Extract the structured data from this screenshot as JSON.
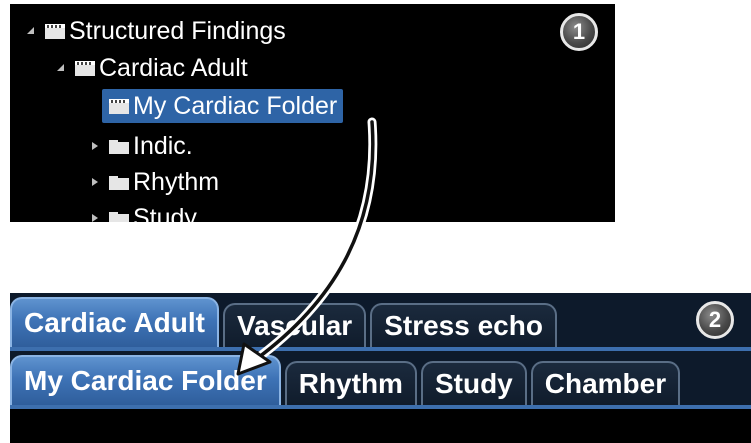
{
  "callouts": {
    "panel1": "1",
    "panel2": "2"
  },
  "tree": {
    "items": [
      {
        "label": "Structured Findings",
        "level": 0,
        "expander": "expanded"
      },
      {
        "label": "Cardiac Adult",
        "level": 1,
        "expander": "expanded"
      },
      {
        "label": "My Cardiac Folder",
        "level": 2,
        "expander": "none",
        "selected": true
      },
      {
        "label": "Indic.",
        "level": 2,
        "expander": "collapsed"
      },
      {
        "label": "Rhythm",
        "level": 2,
        "expander": "collapsed"
      },
      {
        "label": "Study",
        "level": 2,
        "expander": "collapsed"
      }
    ]
  },
  "tabs": {
    "row1": [
      {
        "label": "Cardiac Adult",
        "active": true
      },
      {
        "label": "Vascular",
        "active": false
      },
      {
        "label": "Stress echo",
        "active": false
      }
    ],
    "row2": [
      {
        "label": "My Cardiac Folder",
        "active": true
      },
      {
        "label": "Rhythm",
        "active": false
      },
      {
        "label": "Study",
        "active": false
      },
      {
        "label": "Chamber",
        "active": false
      }
    ]
  },
  "colors": {
    "selection": "#2e64a6",
    "active_tab": "#3e73b6",
    "panel_bg": "#000000",
    "tab_strip_bg": "#0d1a2b"
  },
  "icons": {
    "folder": "folder-icon",
    "expanded": "triangle-down-icon",
    "collapsed": "triangle-right-icon",
    "arrow": "curved-arrow-icon"
  }
}
